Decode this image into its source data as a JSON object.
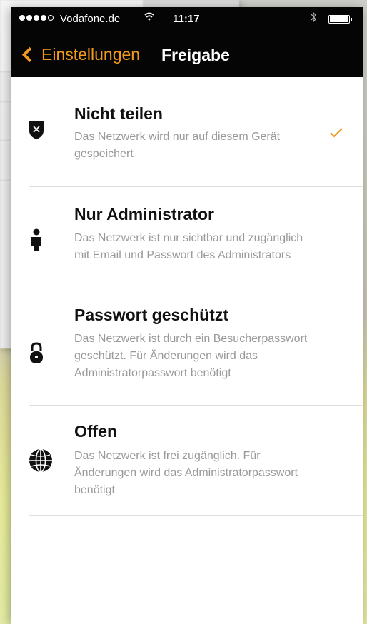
{
  "status": {
    "carrier": "Vodafone.de",
    "time": "11:17",
    "signal_strength": 4,
    "battery_level": 1.0
  },
  "nav": {
    "back_label": "Einstellungen",
    "title": "Freigabe",
    "accent_color": "#f29a1d"
  },
  "options": [
    {
      "title": "Nicht teilen",
      "description": "Das Netzwerk wird nur auf diesem Gerät gespeichert",
      "icon": "shield-x-icon",
      "selected": true
    },
    {
      "title": "Nur Administrator",
      "description": "Das Netzwerk ist nur sichtbar und zugänglich mit Email und Passwort des Administrators",
      "icon": "person-icon",
      "selected": false
    },
    {
      "title": "Passwort geschützt",
      "description": "Das Netzwerk ist durch ein Besucherpasswort geschützt. Für Änderungen wird das Administratorpasswort benötigt",
      "icon": "lock-icon",
      "selected": false
    },
    {
      "title": "Offen",
      "description": "Das Netzwerk ist frei zugänglich. Für Änderungen wird das Administratorpasswort benötigt",
      "icon": "globe-icon",
      "selected": false
    }
  ]
}
